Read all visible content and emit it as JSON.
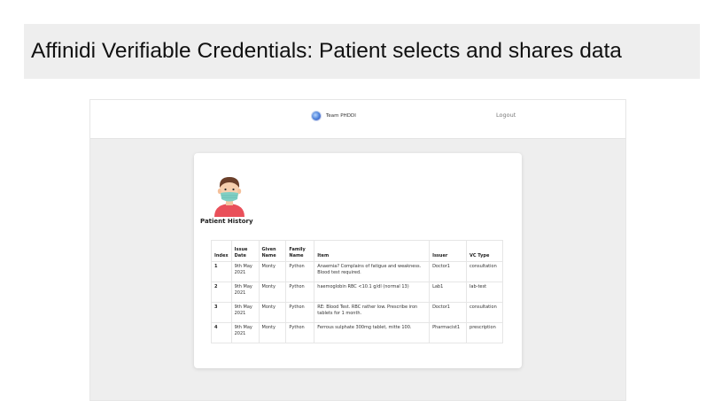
{
  "banner": {
    "title": "Affinidi Verifiable Credentials: Patient selects and shares data"
  },
  "navbar": {
    "brand": "Team PHDDI",
    "logout": "Logout"
  },
  "card": {
    "title": "Patient History"
  },
  "table": {
    "headers": {
      "index": "Index",
      "issue_date": "Issue Date",
      "given_name": "Given Name",
      "family_name": "Family Name",
      "item": "Item",
      "issuer": "Issuer",
      "vc_type": "VC Type"
    },
    "rows": [
      {
        "index": "1",
        "issue_date": "9th May 2021",
        "given_name": "Monty",
        "family_name": "Python",
        "item": "Anaemia? Complains of fatigue and weakness. Blood test required.",
        "issuer": "Doctor1",
        "vc_type": "consultation"
      },
      {
        "index": "2",
        "issue_date": "9th May 2021",
        "given_name": "Monty",
        "family_name": "Python",
        "item": "haemoglobin RBC <10.1 g/dl (normal 13)",
        "issuer": "Lab1",
        "vc_type": "lab-test"
      },
      {
        "index": "3",
        "issue_date": "9th May 2021",
        "given_name": "Monty",
        "family_name": "Python",
        "item": "RE: Blood Test. RBC rather low. Prescribe iron tablets for 1 month.",
        "issuer": "Doctor1",
        "vc_type": "consultation"
      },
      {
        "index": "4",
        "issue_date": "9th May 2021",
        "given_name": "Monty",
        "family_name": "Python",
        "item": "Ferrous sulphate 300mg tablet, mitte 100.",
        "issuer": "Pharmacist1",
        "vc_type": "prescription"
      }
    ]
  },
  "icons": {
    "brand": "globe-logo-icon",
    "avatar": "masked-patient-avatar"
  },
  "colors": {
    "banner_bg": "#eeeeee",
    "page_bg": "#eeeeee",
    "card_bg": "#ffffff",
    "mask": "#7fcfc4",
    "shirt": "#e9505a"
  }
}
